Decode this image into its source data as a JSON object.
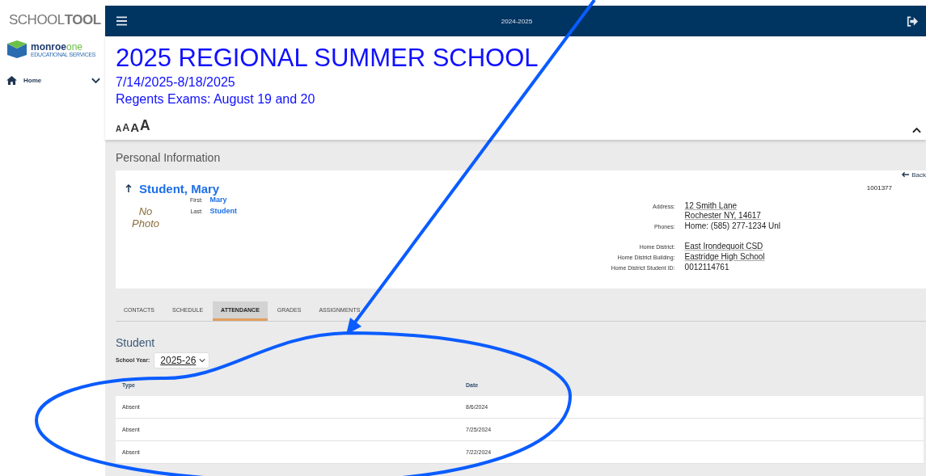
{
  "sidebar": {
    "brand": {
      "prefix": "SCHOOL",
      "suffix": "TOOL"
    },
    "org": {
      "name_a": "monroe",
      "name_b": "one",
      "tagline": "EDUCATIONAL SERVICES"
    },
    "items": [
      {
        "label": "Home",
        "expanded": false
      }
    ]
  },
  "top_bar": {
    "year": "2024-2025"
  },
  "banner": {
    "title": "2025 REGIONAL SUMMER SCHOOL",
    "dates": "7/14/2025-8/18/2025",
    "exams": "Regents Exams:  August 19 and 20",
    "font_sizes": [
      "A",
      "A",
      "A",
      "A"
    ]
  },
  "section_title": "Personal Information",
  "student": {
    "name": "Student, Mary",
    "first_label": "First:",
    "first": "Mary",
    "last_label": "Last:",
    "last": "Student",
    "photo_line1": "No",
    "photo_line2": "Photo",
    "back": "Back",
    "id": "1001377",
    "details": [
      {
        "label": "Address:",
        "lines": [
          "12 Smith Lane",
          "Rochester NY, 14617"
        ],
        "linked": true
      },
      {
        "label": "Phones:",
        "lines": [
          "Home: (585) 277-1234 Unl"
        ],
        "linked": false
      },
      {
        "label": "Home District:",
        "lines": [
          "East Irondequoit  CSD"
        ],
        "linked": true
      },
      {
        "label": "Home District Building:",
        "lines": [
          "Eastridge  High School"
        ],
        "linked": true
      },
      {
        "label": "Home District Student ID:",
        "lines": [
          "0012114761"
        ],
        "linked": false
      }
    ]
  },
  "tabs": [
    {
      "label": "CONTACTS",
      "selected": false
    },
    {
      "label": "SCHEDULE",
      "selected": false
    },
    {
      "label": "ATTENDANCE",
      "selected": true
    },
    {
      "label": "GRADES",
      "selected": false
    },
    {
      "label": "ASSIGNMENTS",
      "selected": false
    }
  ],
  "attendance": {
    "heading": "Student",
    "year_label": "School Year:",
    "year_value": "2025-26",
    "columns": [
      "Type",
      "Date"
    ],
    "rows": [
      [
        "Absent",
        "8/6/2024"
      ],
      [
        "Absent",
        "7/25/2024"
      ],
      [
        "Absent",
        "7/22/2024"
      ]
    ]
  }
}
